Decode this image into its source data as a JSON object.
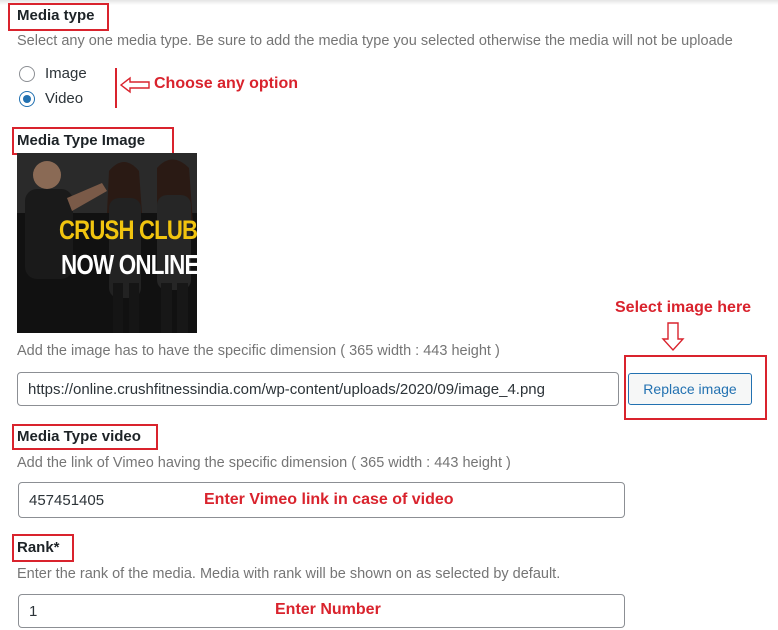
{
  "media_type": {
    "label": "Media type",
    "description": "Select any one media type. Be sure to add the media type you selected otherwise the media will not be uploade",
    "options": [
      {
        "label": "Image",
        "checked": false
      },
      {
        "label": "Video",
        "checked": true
      }
    ],
    "annotation": "Choose any option"
  },
  "media_type_image": {
    "label": "Media Type Image",
    "thumbnail_text_line1": "CRUSH CLUB",
    "thumbnail_text_line2": "NOW ONLINE.",
    "description": "Add the image has to have the specific dimension ( 365 width : 443 height )",
    "url_value": "https://online.crushfitnessindia.com/wp-content/uploads/2020/09/image_4.png",
    "replace_button": "Replace image",
    "annotation": "Select image here"
  },
  "media_type_video": {
    "label": "Media Type video",
    "description": "Add the link of Vimeo having the specific dimension ( 365 width : 443 height )",
    "value": "457451405",
    "annotation": "Enter Vimeo link in case of video"
  },
  "rank": {
    "label": "Rank*",
    "description": "Enter the rank of the media. Media with rank will be shown on as selected by default.",
    "value": "1",
    "annotation": "Enter Number"
  },
  "colors": {
    "annotation_red": "#d9232d",
    "accent_blue": "#2271b1"
  }
}
